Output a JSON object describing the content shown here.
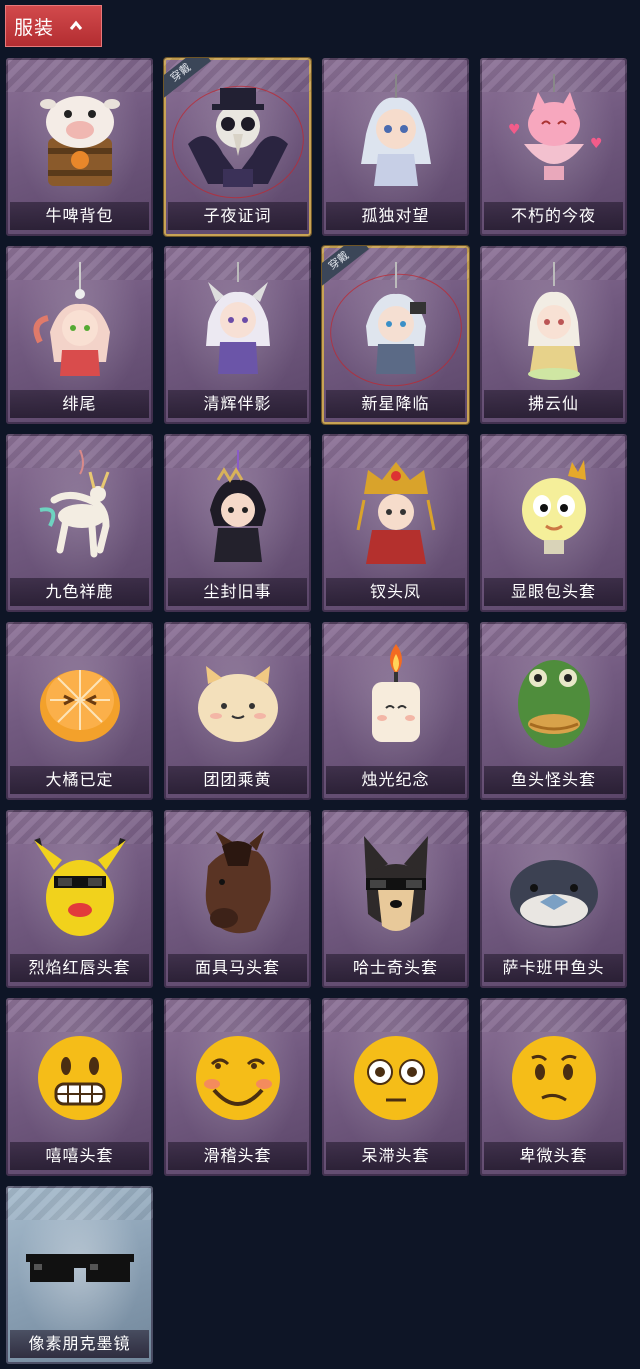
{
  "header": {
    "title": "服装",
    "icon": "chevron-up-icon"
  },
  "items": [
    {
      "label": "牛啤背包",
      "icon": "cow-beer-backpack-icon",
      "equipped": false
    },
    {
      "label": "子夜证词",
      "icon": "plague-doctor-figure-icon",
      "equipped": true,
      "badge": "穿戴"
    },
    {
      "label": "孤独对望",
      "icon": "white-hair-figure-icon",
      "equipped": false
    },
    {
      "label": "不朽的今夜",
      "icon": "pink-cat-bowl-icon",
      "equipped": false
    },
    {
      "label": "绯尾",
      "icon": "fox-girl-charm-icon",
      "equipped": false
    },
    {
      "label": "清辉伴影",
      "icon": "horned-boy-charm-icon",
      "equipped": false
    },
    {
      "label": "新星降临",
      "icon": "silver-hair-charm-icon",
      "equipped": true,
      "badge": "穿戴"
    },
    {
      "label": "拂云仙",
      "icon": "cloud-fairy-charm-icon",
      "equipped": false
    },
    {
      "label": "九色祥鹿",
      "icon": "white-deer-charm-icon",
      "equipped": false
    },
    {
      "label": "尘封旧事",
      "icon": "dark-hair-charm-icon",
      "equipped": false
    },
    {
      "label": "钗头凤",
      "icon": "phoenix-crown-charm-icon",
      "equipped": false
    },
    {
      "label": "显眼包头套",
      "icon": "yellow-bulb-head-icon",
      "equipped": false
    },
    {
      "label": "大橘已定",
      "icon": "orange-slice-head-icon",
      "equipped": false
    },
    {
      "label": "团团乘黄",
      "icon": "fluffy-cat-head-icon",
      "equipped": false
    },
    {
      "label": "烛光纪念",
      "icon": "candle-head-icon",
      "equipped": false
    },
    {
      "label": "鱼头怪头套",
      "icon": "fish-head-mask-icon",
      "equipped": false
    },
    {
      "label": "烈焰红唇头套",
      "icon": "yellow-mouse-head-icon",
      "equipped": false
    },
    {
      "label": "面具马头套",
      "icon": "horse-head-mask-icon",
      "equipped": false
    },
    {
      "label": "哈士奇头套",
      "icon": "husky-head-mask-icon",
      "equipped": false
    },
    {
      "label": "萨卡班甲鱼头",
      "icon": "round-fish-head-icon",
      "equipped": false
    },
    {
      "label": "嘻嘻头套",
      "icon": "grinning-emoji-head-icon",
      "equipped": false
    },
    {
      "label": "滑稽头套",
      "icon": "smirk-emoji-head-icon",
      "equipped": false
    },
    {
      "label": "呆滞头套",
      "icon": "flushed-emoji-head-icon",
      "equipped": false
    },
    {
      "label": "卑微头套",
      "icon": "pleading-emoji-head-icon",
      "equipped": false
    },
    {
      "label": "像素朋克墨镜",
      "icon": "pixel-sunglasses-icon",
      "equipped": false
    }
  ],
  "colors": {
    "background": "#0e1526",
    "header": "#c13a3d",
    "card": "#725a80",
    "equipped_border": "#c8a355",
    "blue_card": "#8aa0b4"
  }
}
